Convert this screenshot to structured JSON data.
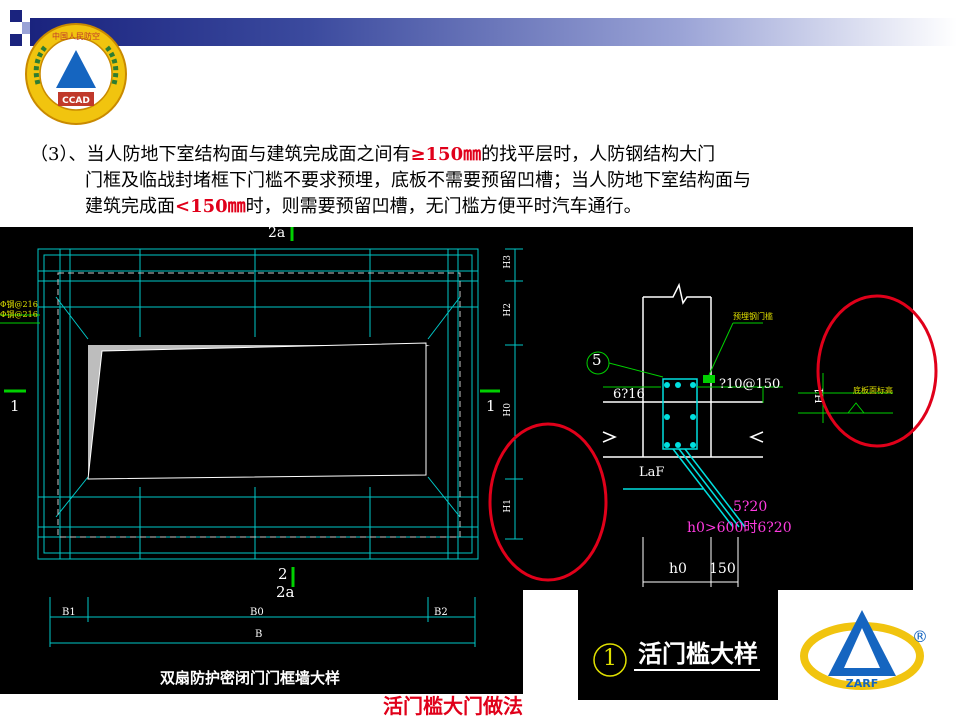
{
  "logos": {
    "top_left": {
      "icon": "ccad-badge-icon",
      "arc_text": "中国人民防空",
      "banner_text": "CCAD"
    },
    "bottom_right": {
      "icon": "zarf-logo-icon",
      "text": "ZARF",
      "mark": "®"
    }
  },
  "paragraph": {
    "line1_a": "（3）、当人防地下室结构面与建筑完成面之间有",
    "line1_red": "≥150㎜",
    "line1_b": "的找平层时，人防钢结构大门",
    "line2": "门框及临战封堵框下门槛不要求预埋，底板不需要预留凹槽；当人防地下室结构面与",
    "line3_a": "建筑完成面",
    "line3_red": "<150㎜",
    "line3_b": "时，则需要预留凹槽，无门槛方便平时汽车通行。"
  },
  "left_drawing": {
    "title": "双扇防护密闭门门框墙大样",
    "top_label": "2a",
    "bottom_label_1": "2",
    "bottom_label_2": "2a",
    "section_left": "1",
    "section_right": "1",
    "dims_right": [
      "H3",
      "H2",
      "H0",
      "H1"
    ],
    "dims_bottom": [
      "B1",
      "B0",
      "B2",
      "B"
    ],
    "note_left_1": "Φ钢@216",
    "note_left_2": "Φ钢@216"
  },
  "right_drawing": {
    "callout_num": "5",
    "rebar_left": "6?16",
    "rebar_right": "?10@150",
    "note_top": "预埋钢门槛",
    "note_right": "底板面标高",
    "anchor_label": "LaF",
    "rebar_bottom_1": "5?20",
    "rebar_bottom_2": "h0>600时6?20",
    "dim_h1": "H1",
    "dim_h0": "h0",
    "dim_150": "150",
    "title_num": "1",
    "title": "活门槛大样"
  },
  "caption": "活门槛大门做法",
  "colors": {
    "accent_red": "#e0001a",
    "cad_cyan": "#00e0e0",
    "cad_green": "#00d000",
    "header_blue": "#1a237e",
    "logo_blue": "#1565c0"
  }
}
